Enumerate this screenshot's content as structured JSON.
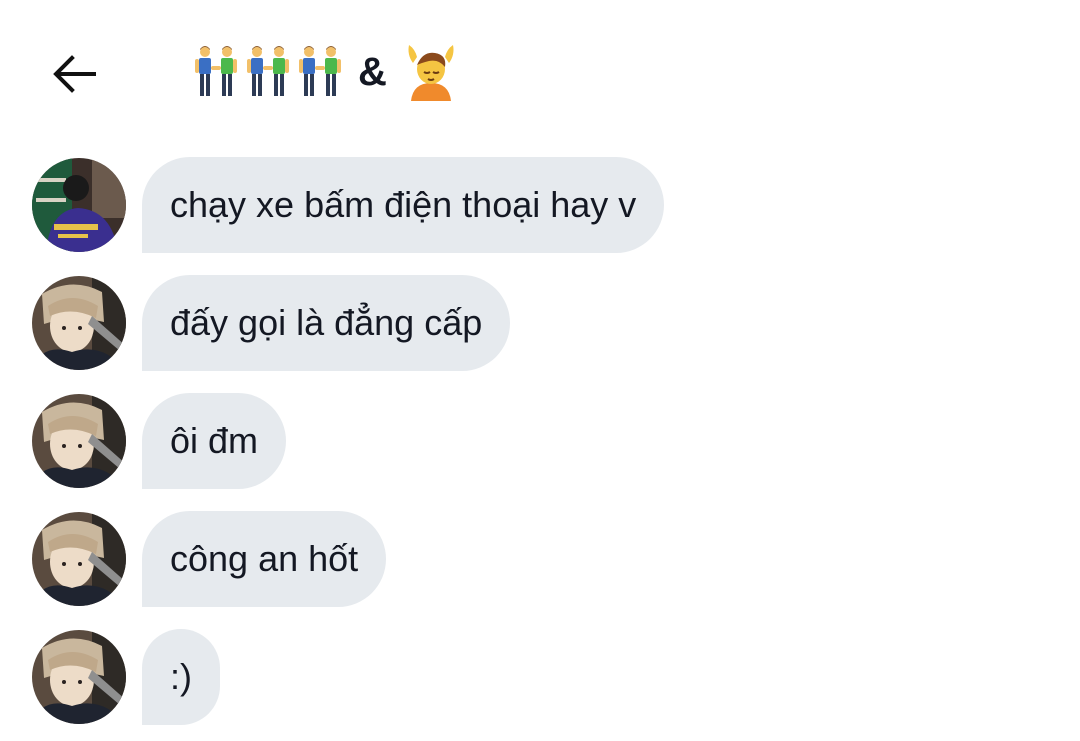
{
  "header": {
    "back_icon": "arrow-left-icon",
    "title_icons": [
      "men-holding-hands-icon",
      "men-holding-hands-icon",
      "men-holding-hands-icon"
    ],
    "title_separator": "&",
    "title_trailing_icon": "person-getting-massage-icon"
  },
  "messages": [
    {
      "text": "chạy xe bấm điện thoại hay v",
      "avatar": "avatar-user-a"
    },
    {
      "text": "đấy gọi là đẳng cấp",
      "avatar": "avatar-user-b"
    },
    {
      "text": "ôi đm",
      "avatar": "avatar-user-b"
    },
    {
      "text": "công an hốt",
      "avatar": "avatar-user-b"
    },
    {
      "text": ":)",
      "avatar": "avatar-user-b"
    }
  ],
  "colors": {
    "bubble_bg": "#e6eaee",
    "text": "#141823",
    "background": "#ffffff"
  }
}
